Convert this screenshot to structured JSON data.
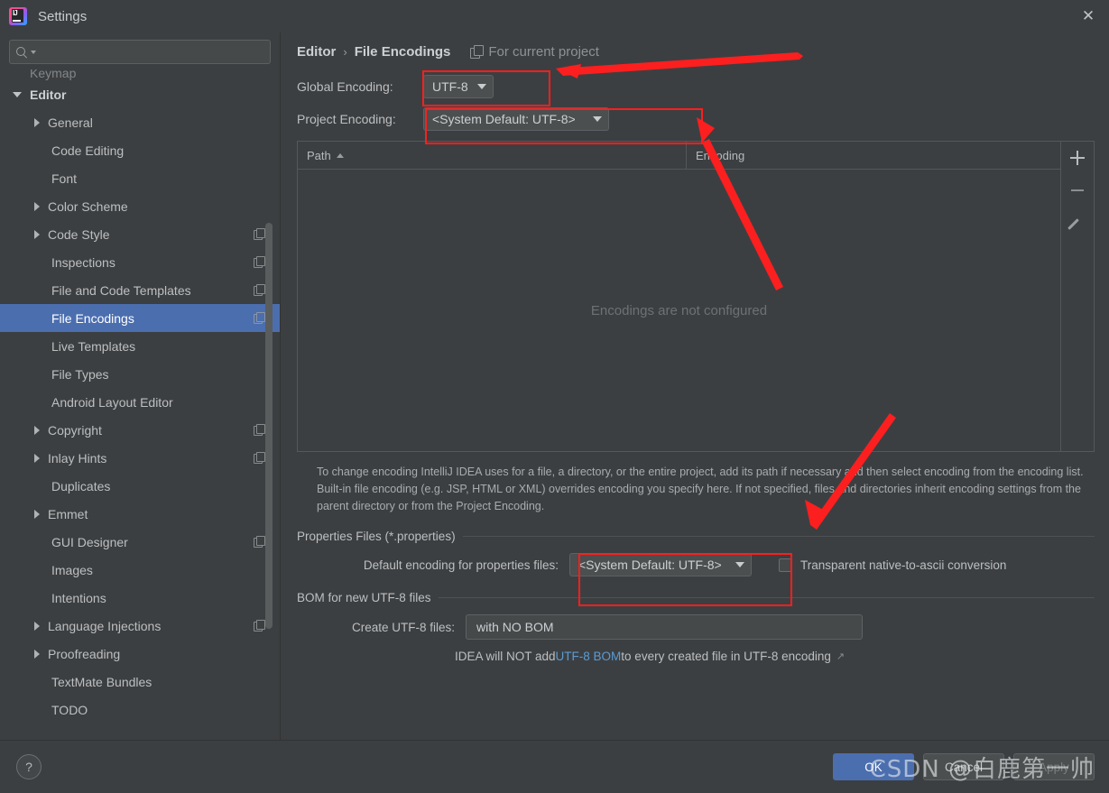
{
  "window": {
    "title": "Settings",
    "close_label": "✕",
    "logo_icon": "intellij-idea-logo"
  },
  "sidebar": {
    "search": {
      "placeholder": "",
      "value": "",
      "icon": "search-icon"
    },
    "clipped_top_item": "Keymap",
    "items": [
      {
        "label": "Editor",
        "indent": 0,
        "twisty": "down",
        "bold": true,
        "copy": false,
        "selected": false
      },
      {
        "label": "General",
        "indent": 1,
        "twisty": "right",
        "bold": false,
        "copy": false,
        "selected": false
      },
      {
        "label": "Code Editing",
        "indent": 1,
        "twisty": "none",
        "bold": false,
        "copy": false,
        "selected": false
      },
      {
        "label": "Font",
        "indent": 1,
        "twisty": "none",
        "bold": false,
        "copy": false,
        "selected": false
      },
      {
        "label": "Color Scheme",
        "indent": 1,
        "twisty": "right",
        "bold": false,
        "copy": false,
        "selected": false
      },
      {
        "label": "Code Style",
        "indent": 1,
        "twisty": "right",
        "bold": false,
        "copy": true,
        "selected": false
      },
      {
        "label": "Inspections",
        "indent": 1,
        "twisty": "none",
        "bold": false,
        "copy": true,
        "selected": false
      },
      {
        "label": "File and Code Templates",
        "indent": 1,
        "twisty": "none",
        "bold": false,
        "copy": true,
        "selected": false
      },
      {
        "label": "File Encodings",
        "indent": 1,
        "twisty": "none",
        "bold": false,
        "copy": true,
        "selected": true
      },
      {
        "label": "Live Templates",
        "indent": 1,
        "twisty": "none",
        "bold": false,
        "copy": false,
        "selected": false
      },
      {
        "label": "File Types",
        "indent": 1,
        "twisty": "none",
        "bold": false,
        "copy": false,
        "selected": false
      },
      {
        "label": "Android Layout Editor",
        "indent": 1,
        "twisty": "none",
        "bold": false,
        "copy": false,
        "selected": false
      },
      {
        "label": "Copyright",
        "indent": 1,
        "twisty": "right",
        "bold": false,
        "copy": true,
        "selected": false
      },
      {
        "label": "Inlay Hints",
        "indent": 1,
        "twisty": "right",
        "bold": false,
        "copy": true,
        "selected": false
      },
      {
        "label": "Duplicates",
        "indent": 1,
        "twisty": "none",
        "bold": false,
        "copy": false,
        "selected": false
      },
      {
        "label": "Emmet",
        "indent": 1,
        "twisty": "right",
        "bold": false,
        "copy": false,
        "selected": false
      },
      {
        "label": "GUI Designer",
        "indent": 1,
        "twisty": "none",
        "bold": false,
        "copy": true,
        "selected": false
      },
      {
        "label": "Images",
        "indent": 1,
        "twisty": "none",
        "bold": false,
        "copy": false,
        "selected": false
      },
      {
        "label": "Intentions",
        "indent": 1,
        "twisty": "none",
        "bold": false,
        "copy": false,
        "selected": false
      },
      {
        "label": "Language Injections",
        "indent": 1,
        "twisty": "right",
        "bold": false,
        "copy": true,
        "selected": false
      },
      {
        "label": "Proofreading",
        "indent": 1,
        "twisty": "right",
        "bold": false,
        "copy": false,
        "selected": false
      },
      {
        "label": "TextMate Bundles",
        "indent": 1,
        "twisty": "none",
        "bold": false,
        "copy": false,
        "selected": false
      },
      {
        "label": "TODO",
        "indent": 1,
        "twisty": "none",
        "bold": false,
        "copy": false,
        "selected": false
      }
    ]
  },
  "main": {
    "breadcrumb": {
      "parent": "Editor",
      "separator": "›",
      "current": "File Encodings",
      "scope_note": "For current project",
      "scope_icon": "copy-badge-icon"
    },
    "global_encoding": {
      "label": "Global Encoding:",
      "value": "UTF-8"
    },
    "project_encoding": {
      "label": "Project Encoding:",
      "value": "<System Default: UTF-8>"
    },
    "table": {
      "columns": [
        "Path",
        "Encoding"
      ],
      "sort_column": "Path",
      "sort_direction": "asc",
      "rows": [],
      "empty_text": "Encodings are not configured",
      "tools": [
        {
          "name": "add",
          "icon": "plus-icon"
        },
        {
          "name": "remove",
          "icon": "minus-icon"
        },
        {
          "name": "edit",
          "icon": "pencil-icon"
        }
      ]
    },
    "note": "To change encoding IntelliJ IDEA uses for a file, a directory, or the entire project, add its path if necessary and then select encoding from the encoding list. Built-in file encoding (e.g. JSP, HTML or XML) overrides encoding you specify here. If not specified, files and directories inherit encoding settings from the parent directory or from the Project Encoding.",
    "properties_group": {
      "title": "Properties Files (*.properties)",
      "default_encoding_label": "Default encoding for properties files:",
      "default_encoding_value": "<System Default: UTF-8>",
      "transparent_label": "Transparent native-to-ascii conversion",
      "transparent_checked": false
    },
    "bom_group": {
      "title": "BOM for new UTF-8 files",
      "create_label": "Create UTF-8 files:",
      "create_value": "with NO BOM",
      "hint_prefix": "IDEA will NOT add ",
      "hint_link": "UTF-8 BOM",
      "hint_suffix": " to every created file in UTF-8 encoding",
      "hint_ext_icon": "↗"
    }
  },
  "footer": {
    "help_label": "?",
    "ok_label": "OK",
    "cancel_label": "Cancel",
    "apply_label": "Apply",
    "apply_enabled": false
  },
  "watermark": {
    "text": "CSDN @白鹿第一帅"
  },
  "colors": {
    "background": "#3c3f41",
    "selection": "#4b6eaf",
    "annotation_red": "#fc1f1f",
    "link_blue": "#5b9bd5",
    "primary_button": "#4b6eaf"
  }
}
